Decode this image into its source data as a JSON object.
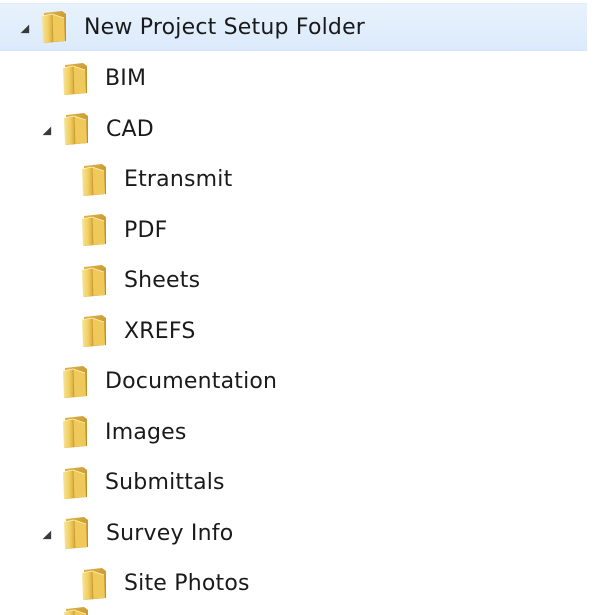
{
  "tree": {
    "items": [
      {
        "label": "New Project Setup Folder",
        "expanded": true,
        "selected": true
      },
      {
        "label": "BIM"
      },
      {
        "label": "CAD",
        "expanded": true
      },
      {
        "label": "Etransmit"
      },
      {
        "label": "PDF"
      },
      {
        "label": "Sheets"
      },
      {
        "label": "XREFS"
      },
      {
        "label": "Documentation"
      },
      {
        "label": "Images"
      },
      {
        "label": "Submittals"
      },
      {
        "label": "Survey Info",
        "expanded": true
      },
      {
        "label": "Site Photos"
      }
    ]
  },
  "colors": {
    "selection": "#dbeafb",
    "folder_light": "#f6e08a",
    "folder_dark": "#d9a93a",
    "text": "#1a1a1a"
  },
  "icons": {
    "expanded_arrow": "expanded-triangle-icon",
    "folder": "folder-icon"
  }
}
